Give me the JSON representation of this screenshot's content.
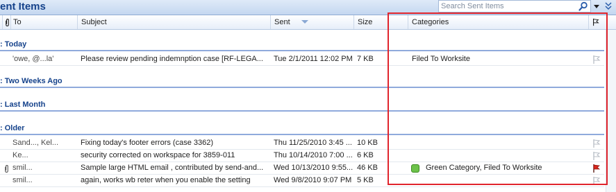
{
  "header": {
    "folder_title": "ent Items",
    "search_placeholder": "Search Sent Items"
  },
  "columns": {
    "to": "To",
    "subject": "Subject",
    "sent": "Sent",
    "size": "Size",
    "categories": "Categories"
  },
  "groups": [
    {
      "label": ": Today"
    },
    {
      "label": ": Two Weeks Ago"
    },
    {
      "label": ": Last Month"
    },
    {
      "label": ": Older"
    }
  ],
  "rows": [
    {
      "to": "'owe, @...la'",
      "subject": "Please review pending indemnption case [RF-LEGA...",
      "sent": "Tue 2/1/2011 12:02 PM",
      "size": "7 KB",
      "categories": "Filed To Worksite",
      "attachment": false,
      "flag": "none"
    },
    {
      "to": "Sand..., Kel...",
      "subject": "Fixing today's footer errors (case 3362)",
      "sent": "Thu 11/25/2010 3:45 ...",
      "size": "10 KB",
      "categories": "",
      "attachment": false,
      "flag": "none"
    },
    {
      "to": "Ke...",
      "subject": "security corrected on workspace for 3859-011",
      "sent": "Thu 10/14/2010 7:00 ...",
      "size": "6 KB",
      "categories": "",
      "attachment": false,
      "flag": "none"
    },
    {
      "to": "smil...",
      "subject": "Sample large HTML email , contributed by send-and...",
      "sent": "Wed 10/13/2010 9:55...",
      "size": "46 KB",
      "categories": "Green Category, Filed To Worksite",
      "attachment": true,
      "flag": "red",
      "category_color": "#6cc24a"
    },
    {
      "to": "smil...",
      "subject": "again, works wb reter when you enable the setting",
      "sent": "Wed 9/8/2010 9:07 PM",
      "size": "5 KB",
      "categories": "",
      "attachment": false,
      "flag": "none"
    }
  ],
  "colors": {
    "accent": "#15428b",
    "highlight": "#e0242c",
    "flag_red": "#d9261c"
  }
}
